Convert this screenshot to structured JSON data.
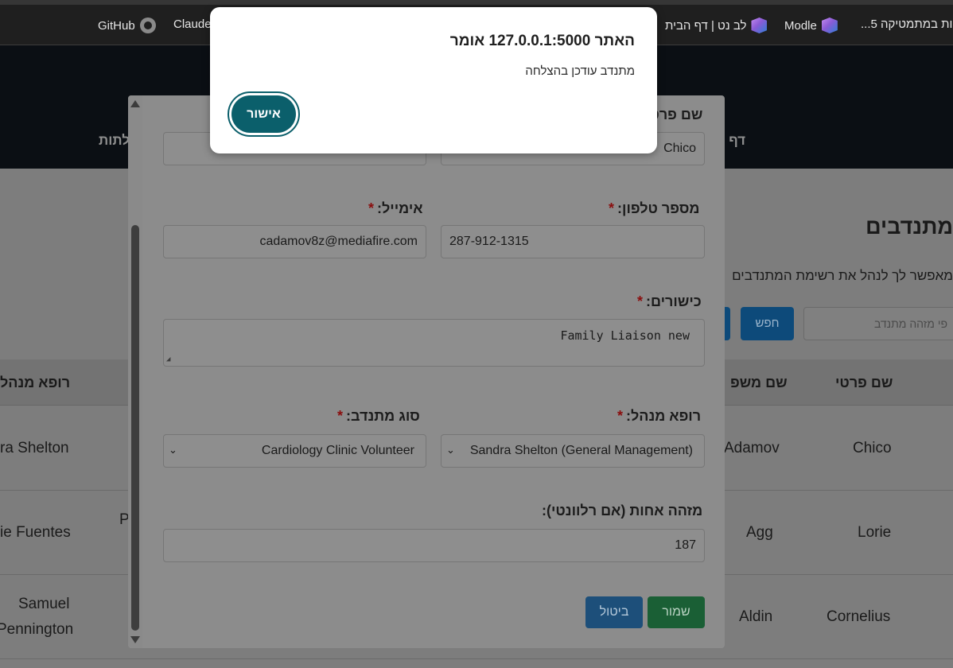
{
  "bookmarks": [
    {
      "label": "GitHub",
      "icon": "github-icon"
    },
    {
      "label": "Claude",
      "icon": ""
    },
    {
      "label": "לב נט | דף הבית",
      "icon": "visual-studio-icon"
    },
    {
      "label": "Modle",
      "icon": "visual-studio-icon"
    },
    {
      "label": "...5 ות במתמטיקה"
    }
  ],
  "navbar": {
    "link_home": "דף ה",
    "link_left": "לתות"
  },
  "page": {
    "title": "מתנדבים",
    "description": "מאפשר לך לנהל את רשימת המתנדבים",
    "search_placeholder": "פי מזהה מתנדב",
    "search_button": "חפש"
  },
  "table": {
    "headers": {
      "first_name": "שם פרטי",
      "last_name": "שם משפ",
      "doctor": "רופא מנהל"
    },
    "rows": [
      {
        "first_name": "Chico",
        "last_name": "Adamov",
        "doctor": "ra Shelton",
        "extra": ""
      },
      {
        "first_name": "Lorie",
        "last_name": "Agg",
        "doctor": "ie Fuentes",
        "extra": "P"
      },
      {
        "first_name": "Cornelius",
        "last_name": "Aldin",
        "doctor_line1": "Samuel",
        "doctor_line2": "Pennington",
        "extra": ""
      }
    ]
  },
  "modal": {
    "first_name_label": "שם פרטי",
    "first_name_value": "Chico",
    "last_name_value": "",
    "phone_label": "מספר טלפון:",
    "phone_value": "287-912-1315",
    "email_label": "אימייל:",
    "email_value": "cadamov8z@mediafire.com",
    "skills_label": "כישורים:",
    "skills_value": "Family Liaison new",
    "doctor_label": "רופא מנהל:",
    "doctor_value": "Sandra Shelton (General Management)",
    "volunteer_type_label": "סוג מתנדב:",
    "volunteer_type_value": "Cardiology Clinic Volunteer",
    "sister_id_label": "מזהה אחות (אם רלוונטי):",
    "sister_id_value": "187",
    "required_mark": "*",
    "save_button": "שמור",
    "cancel_button": "ביטול"
  },
  "alert": {
    "title": "האתר 127.0.0.1:5000 אומר",
    "message": "מתנדב עודכן בהצלחה",
    "ok_button": "אישור"
  },
  "colors": {
    "alert_button": "#0b5f6b",
    "save_button": "#1a5f35",
    "cancel_button": "#1d4f7a",
    "required": "#8a0d0d"
  }
}
